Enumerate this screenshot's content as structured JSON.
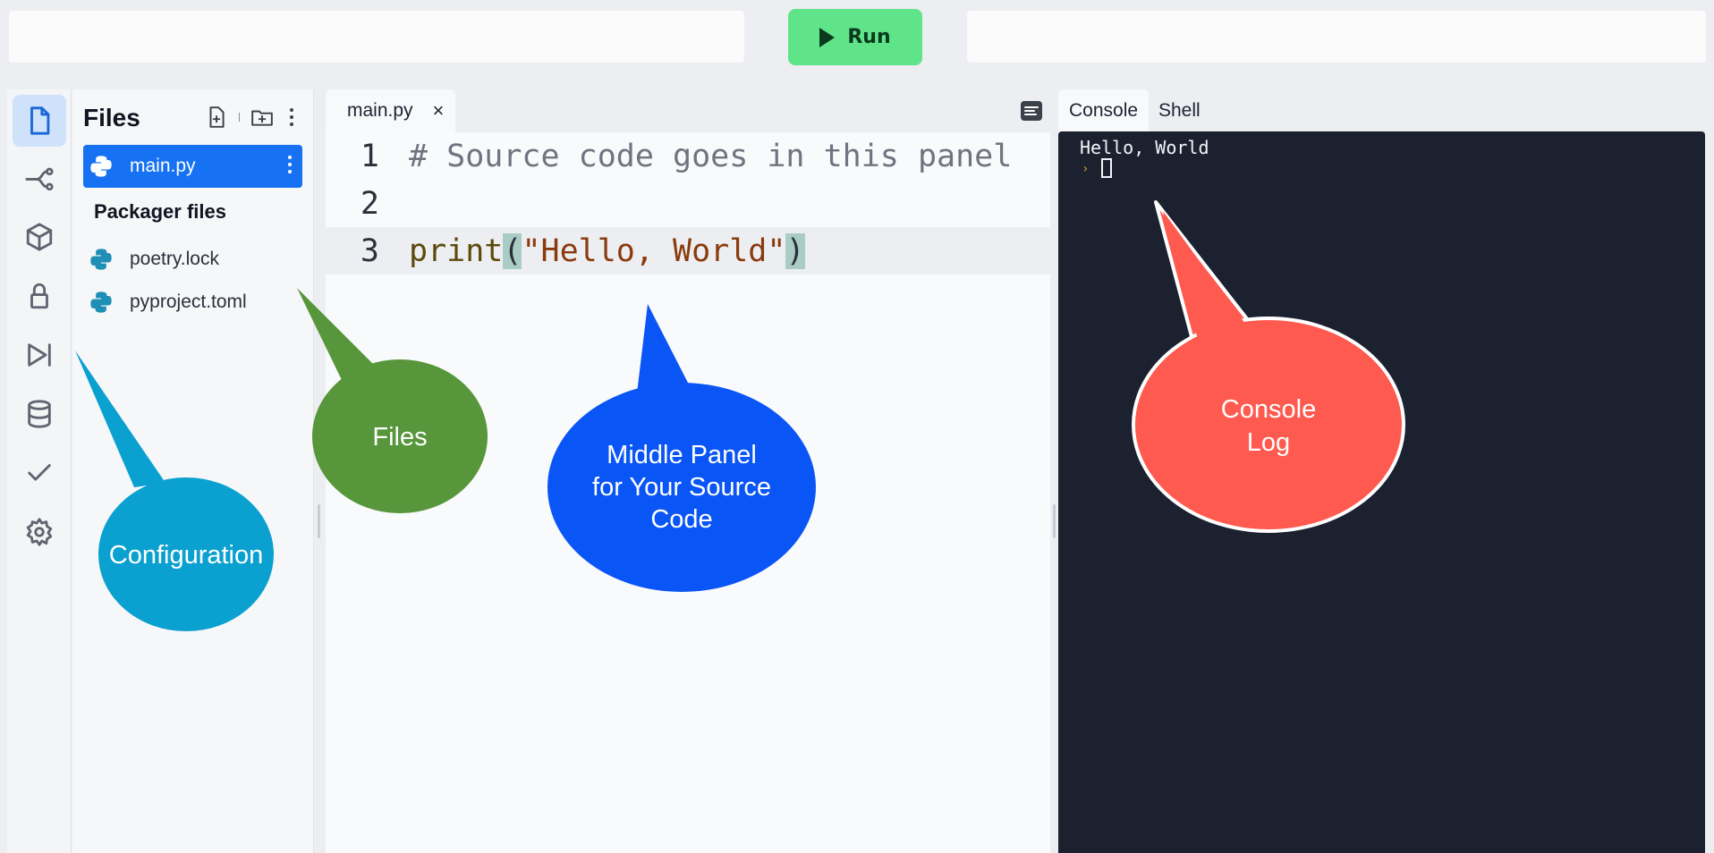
{
  "topbar": {
    "run_label": "Run"
  },
  "activity_bar": {
    "items": [
      {
        "icon": "file-icon",
        "active": true
      },
      {
        "icon": "git-branch-icon",
        "active": false
      },
      {
        "icon": "package-icon",
        "active": false
      },
      {
        "icon": "lock-icon",
        "active": false
      },
      {
        "icon": "play-step-icon",
        "active": false
      },
      {
        "icon": "database-icon",
        "active": false
      },
      {
        "icon": "check-icon",
        "active": false
      },
      {
        "icon": "gear-icon",
        "active": false
      }
    ]
  },
  "files": {
    "title": "Files",
    "items": [
      {
        "name": "main.py",
        "selected": true
      }
    ],
    "packager_title": "Packager files",
    "packager_items": [
      {
        "name": "poetry.lock"
      },
      {
        "name": "pyproject.toml"
      }
    ]
  },
  "editor": {
    "tab_name": "main.py",
    "tab_close": "×",
    "lines": [
      {
        "number": "1",
        "text": "# Source code goes in this panel"
      },
      {
        "number": "2",
        "text": ""
      },
      {
        "number": "3",
        "fn": "print",
        "open": "(",
        "str": "\"Hello, World\"",
        "close": ")"
      }
    ]
  },
  "console": {
    "tabs": [
      "Console",
      "Shell"
    ],
    "output": "Hello, World",
    "prompt": "›"
  },
  "callouts": {
    "configuration": "Configuration",
    "files": "Files",
    "middle_line1": "Middle Panel",
    "middle_line2": "for Your Source",
    "middle_line3": "Code",
    "console_line1": "Console",
    "console_line2": "Log"
  },
  "colors": {
    "run_button": "#60e48a",
    "selected_file": "#1672f3",
    "console_bg": "#1c2130",
    "callout_configuration": "#0aa0cf",
    "callout_files": "#57963a",
    "callout_middle": "#0a55f5",
    "callout_console": "#fe5a4f"
  }
}
